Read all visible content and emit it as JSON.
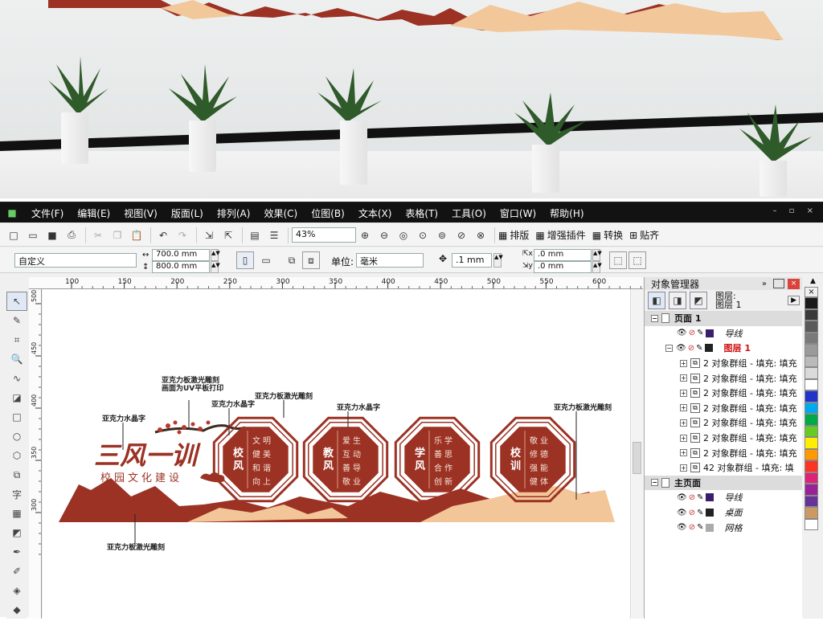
{
  "menu": [
    "文件(F)",
    "编辑(E)",
    "视图(V)",
    "版面(L)",
    "排列(A)",
    "效果(C)",
    "位图(B)",
    "文本(X)",
    "表格(T)",
    "工具(O)",
    "窗口(W)",
    "帮助(H)"
  ],
  "toolbar": {
    "zoom": "43%",
    "layout_label": "排版",
    "plugin_label": "增强插件",
    "convert_label": "转换",
    "paste_label": "贴齐"
  },
  "property_bar": {
    "preset": "自定义",
    "width": "700.0 mm",
    "height": "800.0 mm",
    "unit_label": "单位:",
    "unit": "毫米",
    "nudge": ".1 mm",
    "dup_x": ".0 mm",
    "dup_y": ".0 mm"
  },
  "ruler": {
    "h_ticks": [
      "100",
      "150",
      "200",
      "250",
      "300",
      "350",
      "400",
      "450",
      "500",
      "550",
      "600"
    ],
    "v_ticks": [
      "500",
      "450",
      "400",
      "350",
      "300"
    ]
  },
  "object_manager": {
    "title": "对象管理器",
    "layer_label": "图层:",
    "layer_value": "图层 1",
    "rows": [
      {
        "type": "head",
        "label": "页面 1"
      },
      {
        "type": "layer",
        "label": "导线",
        "color": "#3a1e6e",
        "italic": true
      },
      {
        "type": "layer_active",
        "label": "图层 1",
        "color": "#222"
      },
      {
        "type": "item",
        "label": "2 对象群组 - 填充: 填充"
      },
      {
        "type": "item",
        "label": "2 对象群组 - 填充: 填充"
      },
      {
        "type": "item",
        "label": "2 对象群组 - 填充: 填充"
      },
      {
        "type": "item",
        "label": "2 对象群组 - 填充: 填充"
      },
      {
        "type": "item",
        "label": "2 对象群组 - 填充: 填充"
      },
      {
        "type": "item",
        "label": "2 对象群组 - 填充: 填充"
      },
      {
        "type": "item",
        "label": "2 对象群组 - 填充: 填充"
      },
      {
        "type": "item",
        "label": "42 对象群组 - 填充: 填"
      },
      {
        "type": "head",
        "label": "主页面"
      },
      {
        "type": "layer",
        "label": "导线",
        "color": "#3a1e6e",
        "italic": true
      },
      {
        "type": "layer",
        "label": "桌面",
        "color": "#222",
        "italic": true
      },
      {
        "type": "layer",
        "label": "网格",
        "color": "#aaa",
        "italic": true
      }
    ]
  },
  "palette": [
    "#1a1a1a",
    "#3a3a3a",
    "#5a5a5a",
    "#7a7a7a",
    "#9a9a9a",
    "#bababa",
    "#dadada",
    "#ffffff",
    "#2233cc",
    "#00aaee",
    "#00aa44",
    "#66cc22",
    "#ffee00",
    "#ff9900",
    "#ff3322",
    "#dd2277",
    "#992299",
    "#663399",
    "#cc9966",
    "#ffffff"
  ],
  "design": {
    "title": "三风一训",
    "subtitle": "校园文化建设",
    "panels": [
      {
        "title": "校风",
        "lines": [
          "文明",
          "健美",
          "和谐",
          "向上"
        ]
      },
      {
        "title": "教风",
        "lines": [
          "爱生",
          "互动",
          "善导",
          "敬业"
        ]
      },
      {
        "title": "学风",
        "lines": [
          "乐学",
          "善思",
          "合作",
          "创新"
        ]
      },
      {
        "title": "校训",
        "lines": [
          "敬业",
          "修德",
          "强能",
          "健体"
        ]
      }
    ],
    "annotations": [
      "亚克力板激光雕刻",
      "画面为UV平板打印",
      "亚克力水晶字",
      "亚克力板激光雕刻",
      "亚克力水晶字",
      "亚克力水晶字",
      "亚克力板激光雕刻",
      "亚克力板激光雕刻"
    ],
    "colors": {
      "brand": "#9b3224",
      "sand": "#f3c699"
    }
  }
}
